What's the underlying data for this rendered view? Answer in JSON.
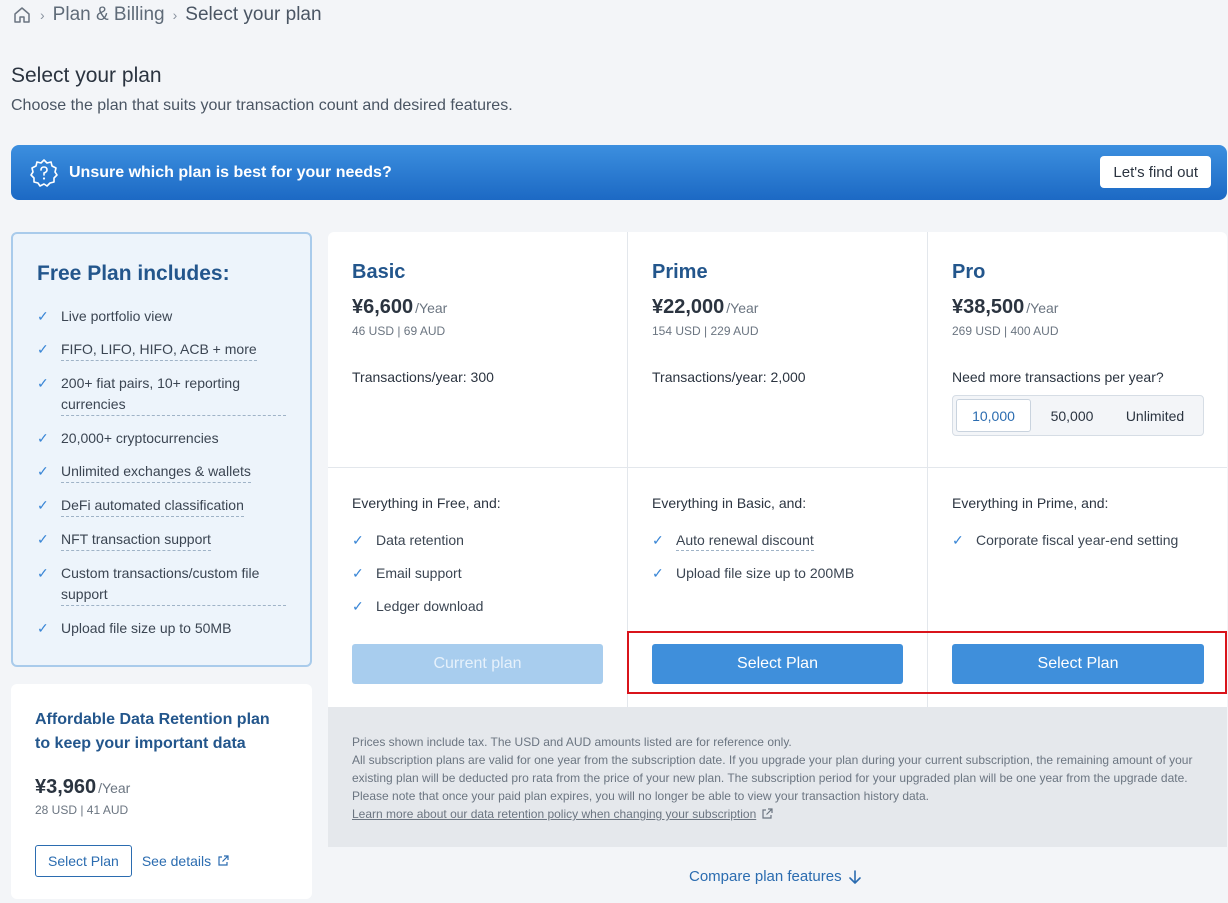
{
  "breadcrumb": {
    "level1": "Plan & Billing",
    "current": "Select your plan",
    "sep": "›"
  },
  "header": {
    "title": "Select your plan",
    "subtitle": "Choose the plan that suits your transaction count and desired features."
  },
  "banner": {
    "text": "Unsure which plan is best for your needs?",
    "button": "Let's find out"
  },
  "free_plan": {
    "title": "Free Plan includes:",
    "items": [
      "Live portfolio view",
      "FIFO, LIFO, HIFO, ACB + more",
      "200+ fiat pairs, 10+ reporting currencies",
      "20,000+ cryptocurrencies",
      "Unlimited exchanges & wallets",
      "DeFi automated classification",
      "NFT transaction support",
      "Custom transactions/custom file support",
      "Upload file size up to 50MB"
    ]
  },
  "data_retention": {
    "title": "Affordable Data Retention plan to keep your important data",
    "price": "¥3,960",
    "per": "/Year",
    "sub": "28 USD | 41 AUD",
    "select": "Select Plan",
    "details": "See details"
  },
  "plans": [
    {
      "name": "Basic",
      "price": "¥6,600",
      "per": "/Year",
      "sub": "46 USD | 69 AUD",
      "tx": "Transactions/year: 300",
      "everything": "Everything in Free, and:",
      "features": [
        "Data retention",
        "Email support",
        "Ledger download"
      ],
      "button": "Current plan"
    },
    {
      "name": "Prime",
      "price": "¥22,000",
      "per": "/Year",
      "sub": "154 USD | 229 AUD",
      "tx": "Transactions/year: 2,000",
      "everything": "Everything in Basic, and:",
      "features": [
        "Auto renewal discount",
        "Upload file size up to 200MB"
      ],
      "button": "Select Plan"
    },
    {
      "name": "Pro",
      "price": "¥38,500",
      "per": "/Year",
      "sub": "269 USD | 400 AUD",
      "tx": "Need more transactions per year?",
      "options": [
        "10,000",
        "50,000",
        "Unlimited"
      ],
      "everything": "Everything in Prime, and:",
      "features": [
        "Corporate fiscal year-end setting"
      ],
      "button": "Select Plan"
    }
  ],
  "notes": {
    "line1": "Prices shown include tax. The USD and AUD amounts listed are for reference only.",
    "line2": "All subscription plans are valid for one year from the subscription date. If you upgrade your plan during your current subscription, the remaining amount of your existing plan will be deducted pro rata from the price of your new plan. The subscription period for your upgraded plan will be one year from the upgrade date. Please note that once your paid plan expires, you will no longer be able to view your transaction history data.",
    "link": "Learn more about our data retention policy when changing your subscription"
  },
  "compare": "Compare plan features",
  "colors": {
    "accent": "#3f8fdb",
    "title": "#23568c",
    "highlight": "#d9141b"
  }
}
